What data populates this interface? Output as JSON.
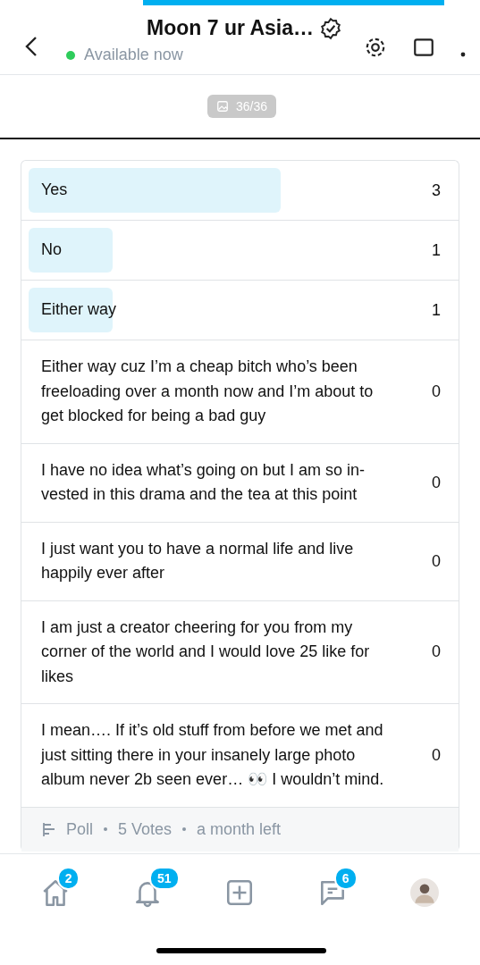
{
  "header": {
    "title": "Moon 7 ur Asia…",
    "verified": true,
    "status": "Available now",
    "online": true
  },
  "media": {
    "counter": "36/36"
  },
  "poll": {
    "options": [
      {
        "label": "Yes",
        "count": "3"
      },
      {
        "label": "No",
        "count": "1"
      },
      {
        "label": "Either way",
        "count": "1"
      },
      {
        "label": "Either way cuz I’m a cheap bitch who’s been freeloading over a month now and I’m about to get blocked for being a bad guy",
        "count": "0"
      },
      {
        "label": "I have no idea what’s going on but I am so in-vested in this drama and the tea at this point",
        "count": "0"
      },
      {
        "label": "I just want you to have a normal life and live happily ever after",
        "count": "0"
      },
      {
        "label": "I am just a creator cheering for you from my corner of the world and I would love 25 like for likes",
        "count": "0"
      },
      {
        "label": "I mean…. If it’s old stuff from before we met and just sitting there in your insanely large photo album never 2b seen ever… 👀 I wouldn’t mind.",
        "count": "0"
      }
    ],
    "footer": [
      "Poll",
      "5 Votes",
      "a month left"
    ]
  },
  "nav": [
    {
      "kind": "home",
      "badge": "2"
    },
    {
      "kind": "bell",
      "badge": "51"
    },
    {
      "kind": "add"
    },
    {
      "kind": "chat",
      "badge": "6"
    },
    {
      "kind": "avatar"
    }
  ]
}
